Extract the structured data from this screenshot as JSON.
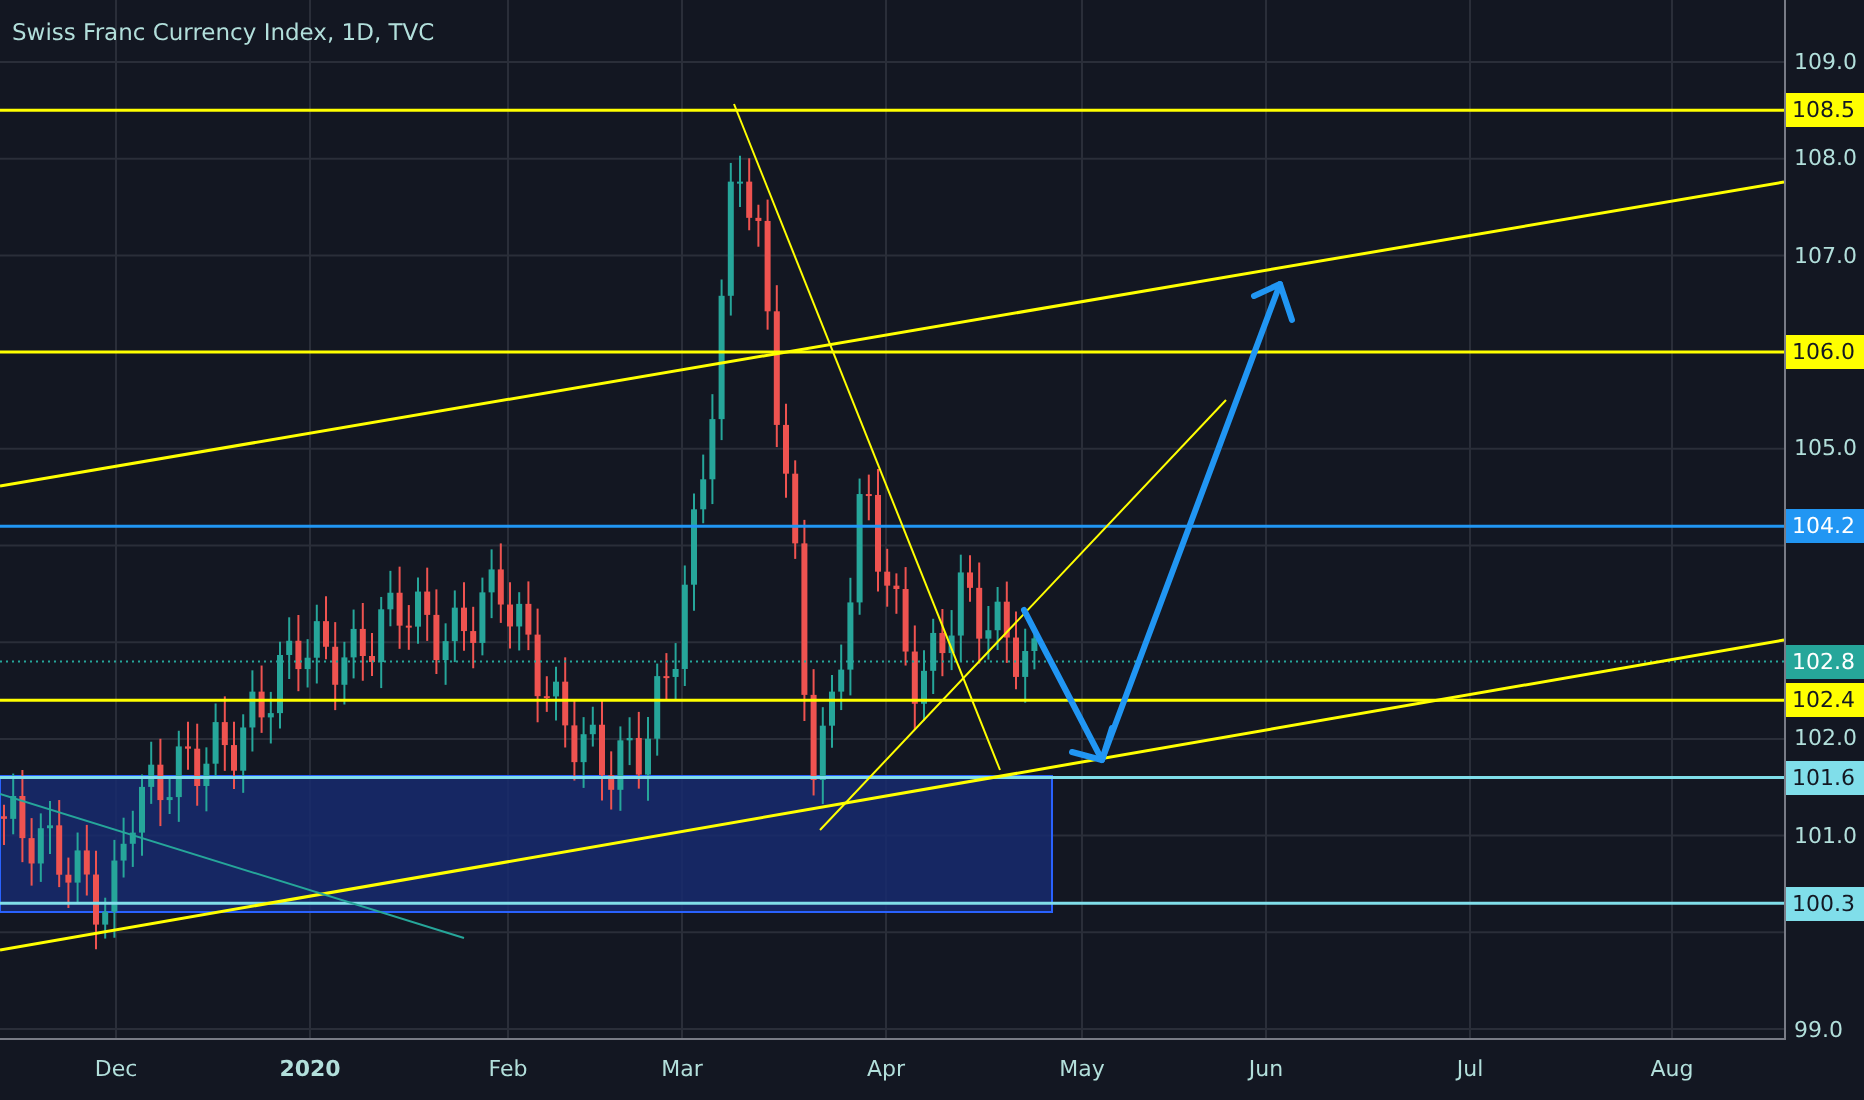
{
  "chart": {
    "title": "Swiss Franc Currency Index, 1D, TVC"
  },
  "price_axis": {
    "ticks": [
      "109.0",
      "108.0",
      "107.0",
      "105.0",
      "102.0",
      "101.0",
      "99.0"
    ],
    "labels": [
      {
        "text": "108.5",
        "color": "#ffff00"
      },
      {
        "text": "106.0",
        "color": "#ffff00"
      },
      {
        "text": "104.2",
        "color": "#2196f3"
      },
      {
        "text": "102.8",
        "color": "#26a69a"
      },
      {
        "text": "102.4",
        "color": "#ffff00"
      },
      {
        "text": "101.6",
        "color": "#80deea"
      },
      {
        "text": "100.3",
        "color": "#80deea"
      }
    ]
  },
  "time_axis": {
    "labels": [
      {
        "text": "Dec",
        "kind": "month"
      },
      {
        "text": "2020",
        "kind": "year"
      },
      {
        "text": "Feb",
        "kind": "month"
      },
      {
        "text": "Mar",
        "kind": "month"
      },
      {
        "text": "Apr",
        "kind": "month"
      },
      {
        "text": "May",
        "kind": "month"
      },
      {
        "text": "Jun",
        "kind": "month"
      },
      {
        "text": "Jul",
        "kind": "month"
      },
      {
        "text": "Aug",
        "kind": "month"
      }
    ]
  }
}
